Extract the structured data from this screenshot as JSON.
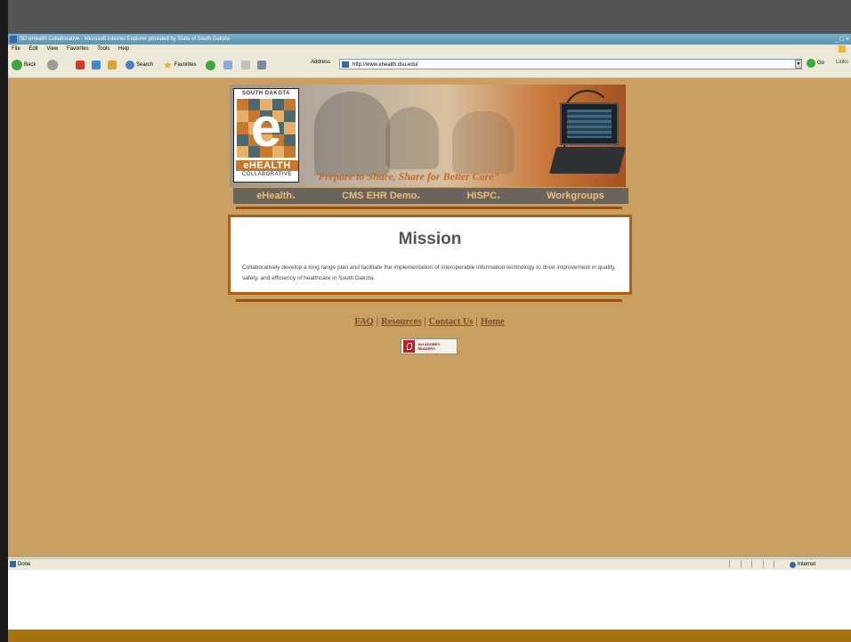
{
  "browser": {
    "title": "SD eHealth Collaborative - Microsoft Internet Explorer provided by State of South Dakota",
    "window_buttons": "_ □ ×",
    "menu": [
      "File",
      "Edit",
      "View",
      "Favorites",
      "Tools",
      "Help"
    ],
    "toolbar": {
      "back": "Back",
      "search": "Search",
      "favorites": "Favorites",
      "address_label": "Address",
      "address_value": "http://www.ehealth.dsu.edu/",
      "go": "Go",
      "links": "Links"
    },
    "status": {
      "text": "Done",
      "zone": "Internet"
    }
  },
  "page": {
    "banner": {
      "logo_top": "SOUTH DAKOTA",
      "logo_letter": "e",
      "logo_name": "eHEALTH",
      "logo_bottom": "COLLABORATIVE",
      "tagline": "\"Prepare to Share, Share for Better Care\""
    },
    "nav": [
      "eHealth",
      "CMS EHR Demo",
      "HISPC",
      "Workgroups"
    ],
    "mission": {
      "title": "Mission",
      "text": "Collaboratively develop a long range plan and facilitate the implementation of interoperable information technology to drive improvement in quality, safety, and efficiency of healthcare in South Dakota."
    },
    "footer_links": [
      "FAQ",
      "Resources",
      "Contact Us",
      "Home"
    ],
    "footer_separator": "|",
    "adobe_badge": "Get ADOBE® READER®"
  },
  "colors": {
    "page_background": "#c9a060",
    "nav_background": "#6b645c",
    "nav_text": "#e8c07a",
    "accent_rule": "#9a5012",
    "tagline": "#c86a24"
  }
}
